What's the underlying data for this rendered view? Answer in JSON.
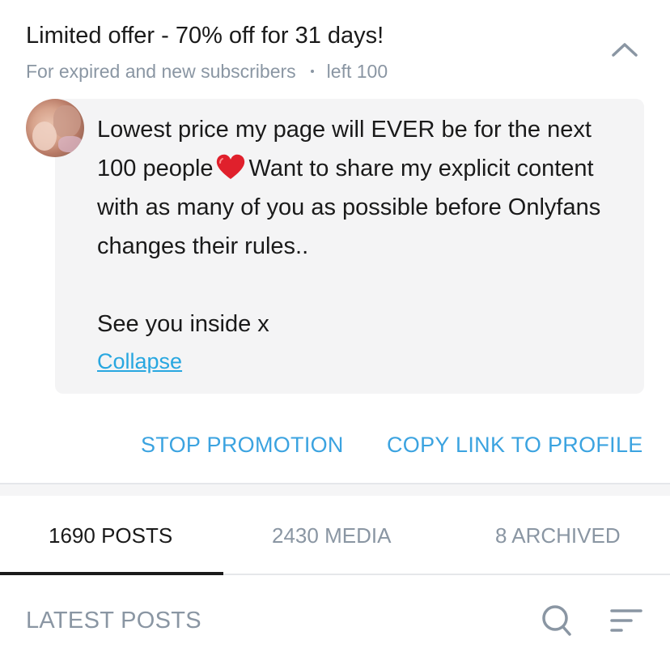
{
  "promo": {
    "title": "Limited offer - 70% off for 31 days!",
    "subtitle": "For expired and new subscribers",
    "remaining": "left 100",
    "message_line1_a": "Lowest price my page will EVER be for the next 100 people",
    "message_line1_b": "Want to share my explicit content with as many of you as possible be­fore Onlyfans changes their rules..",
    "message_line2": "See you inside x",
    "collapse_label": "Collapse",
    "stop_label": "STOP PROMOTION",
    "copy_label": "COPY LINK TO PROFILE"
  },
  "tabs": {
    "posts": "1690 POSTS",
    "media": "2430 MEDIA",
    "archived": "8 ARCHIVED"
  },
  "latest": {
    "title": "LATEST POSTS"
  },
  "colors": {
    "accent": "#3ba3e0",
    "muted": "#8a96a3",
    "heart": "#e0202c"
  },
  "icons": {
    "chevron": "chevron-up-icon",
    "heart": "heart-emoji-icon",
    "search": "search-icon",
    "sort": "sort-icon"
  }
}
